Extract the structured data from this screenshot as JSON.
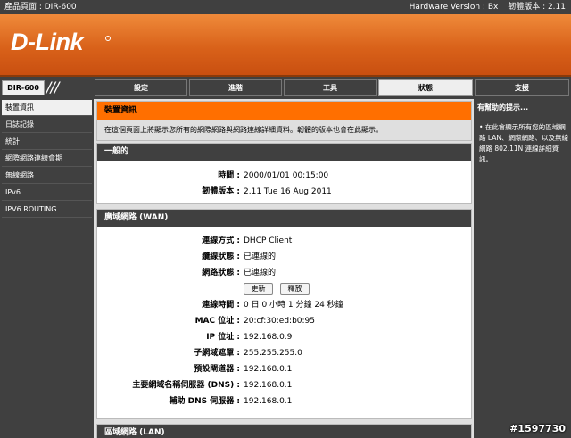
{
  "topbar": {
    "product_page": "產品頁面 : DIR-600",
    "hardware_version": "Hardware Version : Bx",
    "firmware_version": "韌體版本 : 2.11"
  },
  "brand": {
    "logo_text": "D-Link"
  },
  "nav": {
    "model": "DIR-600",
    "tabs": [
      "設定",
      "進階",
      "工具",
      "狀態",
      "支援"
    ],
    "active_tab": "狀態"
  },
  "sidebar": {
    "items": [
      {
        "label": "裝置資訊",
        "active": true
      },
      {
        "label": "日誌記錄"
      },
      {
        "label": "統計"
      },
      {
        "label": "網際網路連線會期"
      },
      {
        "label": "無線網路"
      },
      {
        "label": "IPv6"
      },
      {
        "label": "IPV6 ROUTING"
      }
    ]
  },
  "device_info": {
    "title": "裝置資訊",
    "description": "在這個頁面上將顯示您所有的網際網路與網路連線詳細資料。韌體的版本也會在此顯示。"
  },
  "general": {
    "title": "一般的",
    "time_label": "時間 :",
    "time_value": "2000/01/01 00:15:00",
    "fw_label": "韌體版本 :",
    "fw_value": "2.11 Tue 16 Aug 2011"
  },
  "wan": {
    "title": "廣域網路 (WAN)",
    "rows": [
      {
        "label": "連線方式 :",
        "value": "DHCP Client"
      },
      {
        "label": "纜線狀態 :",
        "value": "已連線的"
      },
      {
        "label": "網路狀態 :",
        "value": "已連線的"
      }
    ],
    "renew_button": "更新",
    "release_button": "釋放",
    "rows2": [
      {
        "label": "連線時間 :",
        "value": "0 日 0 小時 1 分鐘 24 秒鐘"
      },
      {
        "label": "MAC 位址 :",
        "value": "20:cf:30:ed:b0:95"
      },
      {
        "label": "IP 位址 :",
        "value": "192.168.0.9"
      },
      {
        "label": "子網域遮罩 :",
        "value": "255.255.255.0"
      },
      {
        "label": "預設閘道器 :",
        "value": "192.168.0.1"
      },
      {
        "label": "主要網域名稱伺服器 (DNS) :",
        "value": "192.168.0.1"
      },
      {
        "label": "輔助 DNS 伺服器 :",
        "value": "192.168.0.1"
      }
    ]
  },
  "lan": {
    "title": "區域網路 (LAN)"
  },
  "help": {
    "title": "有幫助的提示...",
    "bullet": "• 在此會顯示所有您的區域網路 LAN、網際網路、以及無線網路 802.11N 連線詳細資訊。"
  },
  "watermark": "#1597730",
  "colors": {
    "accent": "#ff6f00",
    "dark": "#404040",
    "panel_bg": "#dfdfdf"
  }
}
